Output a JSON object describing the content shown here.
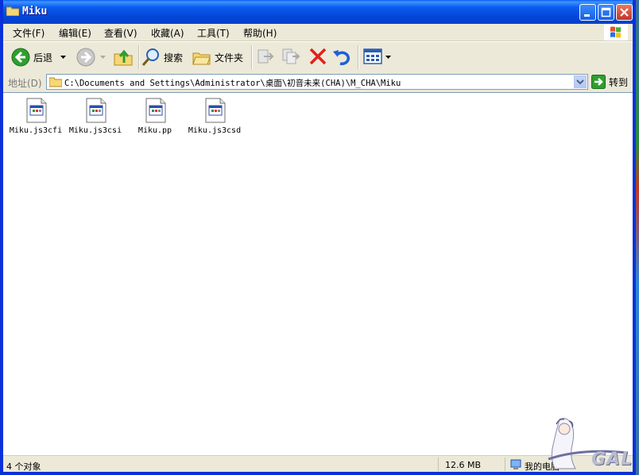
{
  "window": {
    "title": "Miku"
  },
  "menu": {
    "items": [
      "文件(F)",
      "编辑(E)",
      "查看(V)",
      "收藏(A)",
      "工具(T)",
      "帮助(H)"
    ]
  },
  "toolbar": {
    "back_label": "后退",
    "search_label": "搜索",
    "folders_label": "文件夹"
  },
  "address": {
    "label": "地址(D)",
    "path": "C:\\Documents and Settings\\Administrator\\桌面\\初音未来(CHA)\\M_CHA\\Miku",
    "go_label": "转到"
  },
  "files": [
    {
      "name": "Miku.js3cfi"
    },
    {
      "name": "Miku.js3csi"
    },
    {
      "name": "Miku.pp"
    },
    {
      "name": "Miku.js3csd"
    }
  ],
  "status": {
    "object_count": "4 个对象",
    "size": "12.6 MB",
    "location": "我的电脑"
  },
  "watermark": {
    "text": "GAL"
  },
  "colors": {
    "titlebar": "#0a5cf0",
    "frame": "#0831d9",
    "chrome": "#ece9d8",
    "delete_red": "#e0201b",
    "nav_green": "#2f9e2f"
  }
}
